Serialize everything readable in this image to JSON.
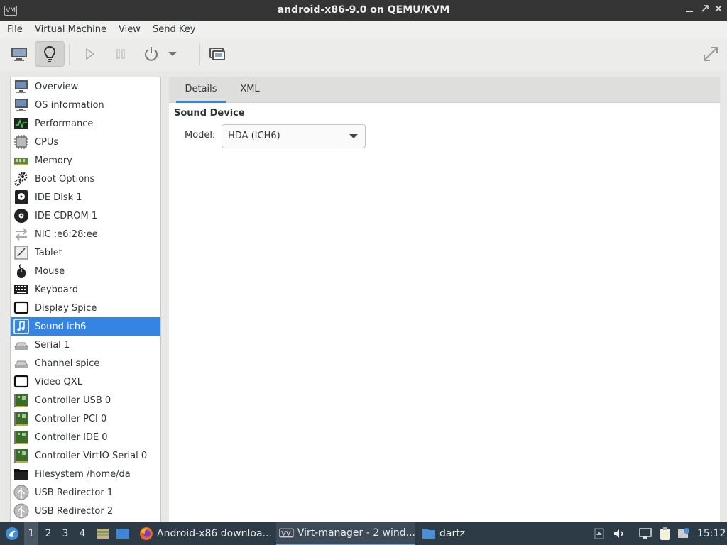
{
  "window": {
    "title": "android-x86-9.0 on QEMU/KVM",
    "app_icon_glyph": "VM"
  },
  "menu": [
    "File",
    "Virtual Machine",
    "View",
    "Send Key"
  ],
  "toolbar": {
    "buttons": [
      "console-icon",
      "details-lightbulb-icon",
      "run-icon",
      "pause-icon",
      "power-icon",
      "chevron-down-icon",
      "screenshot-icon",
      "fullscreen-icon"
    ]
  },
  "sidebar": {
    "items": [
      {
        "label": "Overview",
        "icon": "monitor-icon"
      },
      {
        "label": "OS information",
        "icon": "monitor-icon"
      },
      {
        "label": "Performance",
        "icon": "performance-icon"
      },
      {
        "label": "CPUs",
        "icon": "cpu-icon"
      },
      {
        "label": "Memory",
        "icon": "memory-icon"
      },
      {
        "label": "Boot Options",
        "icon": "gears-icon"
      },
      {
        "label": "IDE Disk 1",
        "icon": "disk-icon"
      },
      {
        "label": "IDE CDROM 1",
        "icon": "cdrom-icon"
      },
      {
        "label": "NIC :e6:28:ee",
        "icon": "network-arrows-icon"
      },
      {
        "label": "Tablet",
        "icon": "tablet-icon"
      },
      {
        "label": "Mouse",
        "icon": "mouse-icon"
      },
      {
        "label": "Keyboard",
        "icon": "keyboard-icon"
      },
      {
        "label": "Display Spice",
        "icon": "display-icon"
      },
      {
        "label": "Sound ich6",
        "icon": "sound-icon",
        "selected": true
      },
      {
        "label": "Serial 1",
        "icon": "serial-icon"
      },
      {
        "label": "Channel spice",
        "icon": "serial-icon"
      },
      {
        "label": "Video QXL",
        "icon": "display-icon"
      },
      {
        "label": "Controller USB 0",
        "icon": "controller-card-icon"
      },
      {
        "label": "Controller PCI 0",
        "icon": "controller-card-icon"
      },
      {
        "label": "Controller IDE 0",
        "icon": "controller-card-icon"
      },
      {
        "label": "Controller VirtIO Serial 0",
        "icon": "controller-card-icon"
      },
      {
        "label": "Filesystem /home/da",
        "icon": "folder-icon"
      },
      {
        "label": "USB Redirector 1",
        "icon": "usb-icon"
      },
      {
        "label": "USB Redirector 2",
        "icon": "usb-icon"
      }
    ]
  },
  "main": {
    "tabs": [
      {
        "label": "Details",
        "active": true
      },
      {
        "label": "XML",
        "active": false
      }
    ],
    "section_title": "Sound Device",
    "model_label": "Model:",
    "model_value": "HDA (ICH6)"
  },
  "taskbar": {
    "workspaces": [
      "1",
      "2",
      "3",
      "4"
    ],
    "active_workspace": "1",
    "tasks": [
      {
        "label": "Android-x86 downloa...",
        "icon": "firefox-icon"
      },
      {
        "label": "Virt-manager - 2 wind...",
        "icon": "virt-manager-icon",
        "active": true
      },
      {
        "label": "dartz",
        "icon": "folder-icon"
      }
    ],
    "clock": "15:12"
  },
  "colors": {
    "accent": "#3584e4",
    "titlebar": "#353535",
    "taskbar": "#2d3b47"
  }
}
